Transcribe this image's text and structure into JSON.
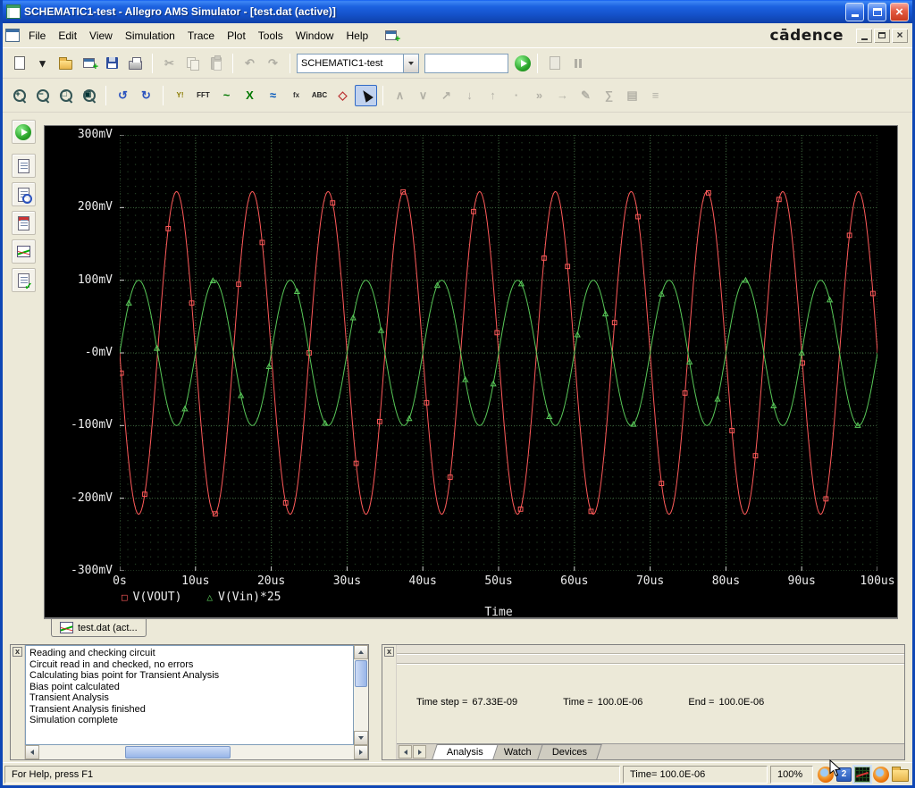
{
  "window": {
    "title": "SCHEMATIC1-test - Allegro AMS Simulator - [test.dat (active)]"
  },
  "brand": {
    "logo_text": "cādence"
  },
  "menu": {
    "items": [
      "File",
      "Edit",
      "View",
      "Simulation",
      "Trace",
      "Plot",
      "Tools",
      "Window",
      "Help"
    ]
  },
  "toolbars": {
    "main": {
      "file_group": [
        {
          "name": "new-button",
          "icon": "page"
        },
        {
          "name": "new-dropdown-button",
          "icon": "txt",
          "glyph": "▾",
          "color": "#222222"
        },
        {
          "name": "open-button",
          "icon": "folder"
        },
        {
          "name": "append-file-button",
          "icon": "winplus"
        },
        {
          "name": "save-button",
          "icon": "floppy"
        },
        {
          "name": "print-button",
          "icon": "printer"
        }
      ],
      "clipboard_group": [
        {
          "name": "cut-button",
          "icon": "txt",
          "glyph": "✂",
          "color": "#445566",
          "disabled": true
        },
        {
          "name": "copy-button",
          "icon": "copy",
          "disabled": true
        },
        {
          "name": "paste-button",
          "icon": "paste",
          "disabled": true
        }
      ],
      "undo_group": [
        {
          "name": "undo-button",
          "icon": "txt",
          "glyph": "↶",
          "color": "#2a52be",
          "disabled": true
        },
        {
          "name": "redo-button",
          "icon": "txt",
          "glyph": "↷",
          "color": "#2a52be",
          "disabled": true
        }
      ],
      "profile_combo_value": "SCHEMATIC1-test",
      "sim_combo_value": "",
      "post_run_group": [
        {
          "name": "edit-profile-button",
          "icon": "pagegray",
          "disabled": true
        },
        {
          "name": "pause-simulation-button",
          "icon": "pause",
          "disabled": true
        }
      ]
    },
    "probe": {
      "zoom_group": [
        {
          "name": "zoom-in-button",
          "icon": "zoom",
          "glyph": "+"
        },
        {
          "name": "zoom-out-button",
          "icon": "zoom",
          "glyph": "−"
        },
        {
          "name": "zoom-area-button",
          "icon": "zoom",
          "glyph": "□"
        },
        {
          "name": "zoom-fit-button",
          "icon": "zoom",
          "glyph": "▣"
        }
      ],
      "view_group": [
        {
          "name": "previous-view-button",
          "icon": "txt",
          "glyph": "↺",
          "color": "#2a52be"
        },
        {
          "name": "redraw-plot-button",
          "icon": "txt",
          "glyph": "↻",
          "color": "#2a52be"
        }
      ],
      "trace_group": [
        {
          "name": "log-y-axis-button",
          "icon": "txt",
          "glyph": "Y!",
          "color": "#8a7a00"
        },
        {
          "name": "fft-button",
          "icon": "txt",
          "glyph": "FFT",
          "color": "#222222"
        },
        {
          "name": "add-trace-button",
          "icon": "txt",
          "glyph": "~",
          "color": "#007700"
        },
        {
          "name": "log-x-axis-button",
          "icon": "txt",
          "glyph": "X",
          "color": "#007700"
        },
        {
          "name": "performance-analysis-button",
          "icon": "txt",
          "glyph": "≈",
          "color": "#0055bb"
        },
        {
          "name": "eval-function-button",
          "icon": "txt",
          "glyph": "fx",
          "color": "#333333"
        },
        {
          "name": "text-label-button",
          "icon": "txt",
          "glyph": "ABC",
          "color": "#222222"
        },
        {
          "name": "mark-data-points-button",
          "icon": "txt",
          "glyph": "◇",
          "color": "#bb3333"
        },
        {
          "name": "cursor-toggle-button",
          "icon": "cursor",
          "active": true
        }
      ],
      "cursor_group": [
        {
          "name": "cursor-peak-button",
          "icon": "txt",
          "glyph": "∧",
          "color": "#555555",
          "disabled": true
        },
        {
          "name": "cursor-trough-button",
          "icon": "txt",
          "glyph": "∨",
          "color": "#555555",
          "disabled": true
        },
        {
          "name": "cursor-slope-button",
          "icon": "txt",
          "glyph": "↗",
          "color": "#555555",
          "disabled": true
        },
        {
          "name": "cursor-min-button",
          "icon": "txt",
          "glyph": "↓",
          "color": "#555555",
          "disabled": true
        },
        {
          "name": "cursor-max-button",
          "icon": "txt",
          "glyph": "↑",
          "color": "#555555",
          "disabled": true
        },
        {
          "name": "cursor-point-button",
          "icon": "txt",
          "glyph": "∙",
          "color": "#555555",
          "disabled": true
        },
        {
          "name": "cursor-search-button",
          "icon": "txt",
          "glyph": "»",
          "color": "#555555",
          "disabled": true
        },
        {
          "name": "cursor-next-transition-button",
          "icon": "txt",
          "glyph": "→",
          "color": "#555555",
          "disabled": true
        },
        {
          "name": "mark-label-button",
          "icon": "txt",
          "glyph": "✎",
          "color": "#555555",
          "disabled": true
        },
        {
          "name": "eval-goal-function-button",
          "icon": "txt",
          "glyph": "∑",
          "color": "#555555",
          "disabled": true
        },
        {
          "name": "copy-plot-button",
          "icon": "txt",
          "glyph": "▤",
          "color": "#555555",
          "disabled": true
        },
        {
          "name": "plot-properties-button",
          "icon": "txt",
          "glyph": "≡",
          "color": "#555555",
          "disabled": true
        }
      ]
    }
  },
  "side_toolbar": [
    {
      "name": "simulation-status-button",
      "icon": "playcirc"
    },
    {
      "name": "view-output-file-button",
      "icon": "doc"
    },
    {
      "name": "view-netlist-button",
      "icon": "docsearch"
    },
    {
      "name": "view-circuit-file-button",
      "icon": "docred"
    },
    {
      "name": "view-simulation-results-button",
      "icon": "chart"
    },
    {
      "name": "edit-simulation-profile-button",
      "icon": "doccheck"
    }
  ],
  "plot": {
    "tab_label": "test.dat (act...",
    "marker_glyphs": {
      "square": "□",
      "triangle": "△"
    }
  },
  "chart_data": {
    "type": "line",
    "title": "",
    "xlabel": "Time",
    "x_unit": "us",
    "y_unit": "mV",
    "xlim_us": [
      0,
      100
    ],
    "ylim_mV": [
      -300,
      300
    ],
    "x_ticks": [
      "0s",
      "10us",
      "20us",
      "30us",
      "40us",
      "50us",
      "60us",
      "70us",
      "80us",
      "90us",
      "100us"
    ],
    "y_ticks": [
      "300mV",
      "200mV",
      "100mV",
      "-0mV",
      "-100mV",
      "-200mV",
      "-300mV"
    ],
    "grid": "dotted",
    "background": "#000000",
    "legend_position": "bottom-left",
    "series": [
      {
        "name": "V(VOUT)",
        "waveform": "sine",
        "amplitude_mV": 222,
        "period_us": 10,
        "phase_deg": 180,
        "offset_mV": 0,
        "color": "#ff5a5a",
        "marker": "square",
        "marker_step_us": 3.1,
        "marker_start_us": 0.2
      },
      {
        "name": "V(Vin)*25",
        "waveform": "sine",
        "amplitude_mV": 100,
        "period_us": 10,
        "phase_deg": 0,
        "offset_mV": 0,
        "color": "#58c858",
        "marker": "triangle",
        "marker_step_us": 3.7,
        "marker_start_us": 1.2
      }
    ]
  },
  "output_log": {
    "lines": [
      "Reading and checking circuit",
      "Circuit read in and checked, no errors",
      "Calculating bias point for Transient Analysis",
      "Bias point calculated",
      "Transient Analysis",
      "Transient Analysis finished",
      "Simulation complete"
    ]
  },
  "sim_status": {
    "time_step_label": "Time step =",
    "time_step_value": "67.33E-09",
    "time_label": "Time =",
    "time_value": "100.0E-06",
    "end_label": "End =",
    "end_value": "100.0E-06",
    "tabs": [
      {
        "label": "Analysis",
        "active": true
      },
      {
        "label": "Watch",
        "active": false
      },
      {
        "label": "Devices",
        "active": false
      }
    ]
  },
  "statusbar": {
    "help_text": "For Help, press F1",
    "time_text": "Time= 100.0E-06",
    "zoom_text": "100%",
    "tray": [
      {
        "name": "firefox-icon",
        "type": "firefox"
      },
      {
        "name": "messenger-badge-icon",
        "type": "badge",
        "label": "2"
      },
      {
        "name": "simulator-tray-icon",
        "type": "simtray"
      },
      {
        "name": "firefox-icon-2",
        "type": "firefox"
      },
      {
        "name": "folder-icon",
        "type": "folder"
      }
    ]
  }
}
